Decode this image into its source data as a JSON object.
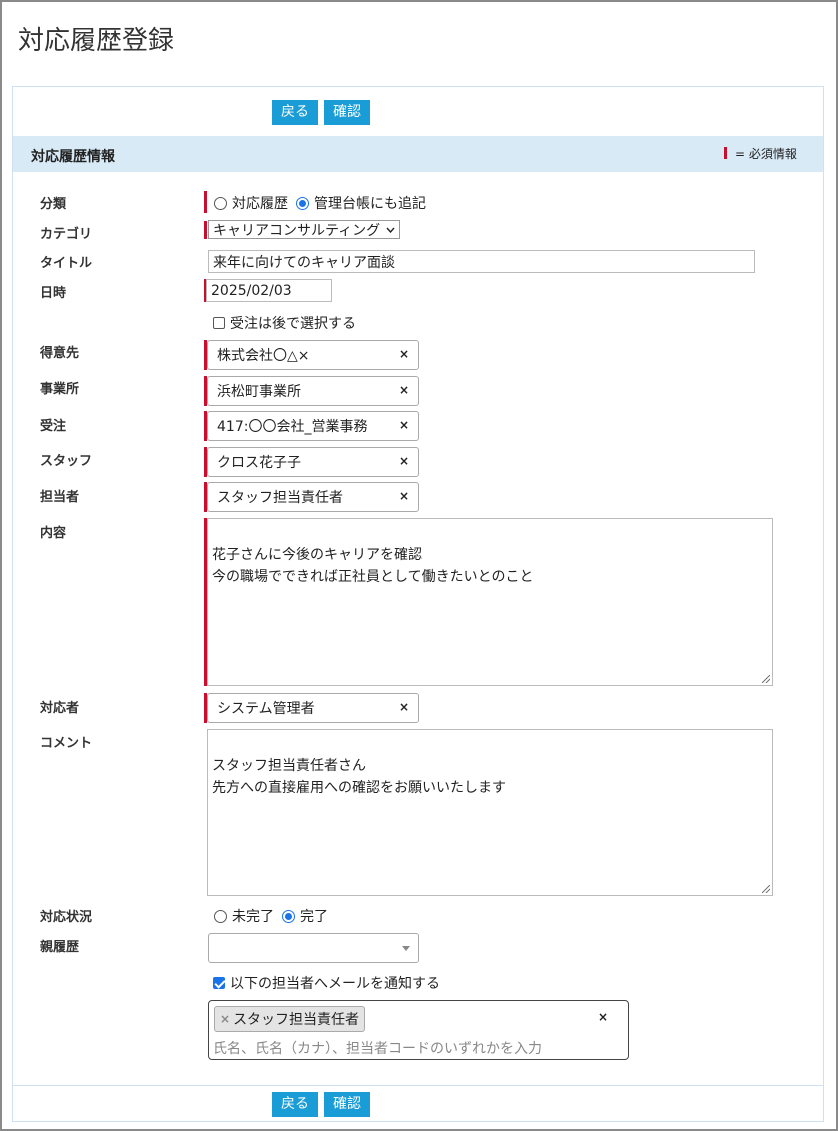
{
  "page": {
    "title": "対応履歴登録"
  },
  "actions": {
    "back": "戻る",
    "confirm": "確認"
  },
  "section": {
    "title": "対応履歴情報",
    "required_legend": "= 必須情報"
  },
  "fields": {
    "classification": {
      "label": "分類",
      "options": [
        "対応履歴",
        "管理台帳にも追記"
      ],
      "selected": "管理台帳にも追記"
    },
    "category": {
      "label": "カテゴリ",
      "value": "キャリアコンサルティング"
    },
    "title": {
      "label": "タイトル",
      "value": "来年に向けてのキャリア面談"
    },
    "datetime": {
      "label": "日時",
      "value": "2025/02/03"
    },
    "order_later": {
      "label": "受注は後で選択する",
      "checked": false
    },
    "customer": {
      "label": "得意先",
      "value": "株式会社〇△×"
    },
    "office": {
      "label": "事業所",
      "value": "浜松町事業所"
    },
    "order": {
      "label": "受注",
      "value": "417:〇〇会社_営業事務"
    },
    "staff": {
      "label": "スタッフ",
      "value": "クロス花子子"
    },
    "person_in_charge": {
      "label": "担当者",
      "value": "スタッフ担当責任者"
    },
    "content": {
      "label": "内容",
      "value": "花子さんに今後のキャリアを確認\n今の職場でできれば正社員として働きたいとのこと"
    },
    "responder": {
      "label": "対応者",
      "value": "システム管理者"
    },
    "comment": {
      "label": "コメント",
      "value": "スタッフ担当責任者さん\n先方への直接雇用への確認をお願いいたします"
    },
    "status": {
      "label": "対応状況",
      "options": [
        "未完了",
        "完了"
      ],
      "selected": "完了"
    },
    "parent_history": {
      "label": "親履歴",
      "value": ""
    },
    "notify_mail": {
      "label": "以下の担当者へメールを通知する",
      "checked": true
    },
    "notify_recipients": {
      "tags": [
        "スタッフ担当責任者"
      ],
      "placeholder": "氏名、氏名（カナ）、担当者コードのいずれかを入力"
    }
  },
  "icons": {
    "clear": "×",
    "remove_tag": "×"
  },
  "colors": {
    "button": "#1a9cd6",
    "required": "#c8102e",
    "section_bg": "#d9eaf7",
    "radio_checked": "#1a73e8"
  }
}
